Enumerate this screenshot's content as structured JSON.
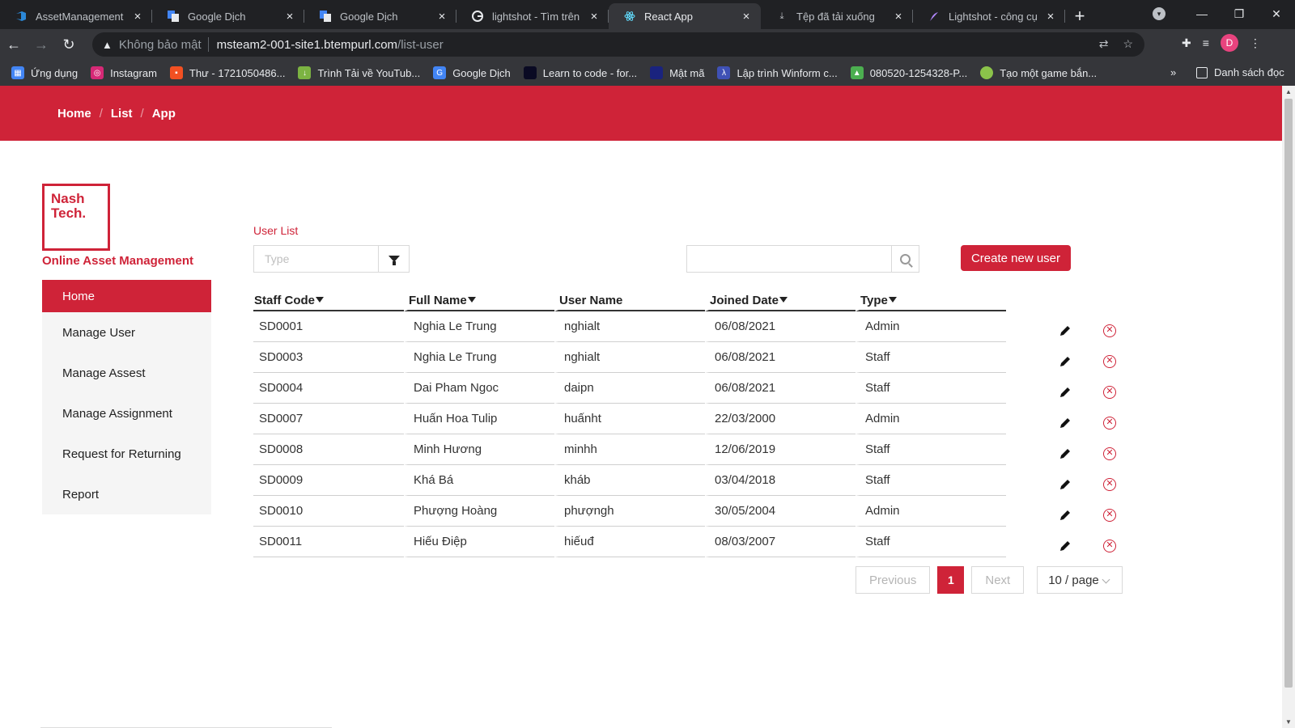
{
  "browser": {
    "tabs": [
      {
        "title": "AssetManagement Te",
        "icon": "azure-devops-icon",
        "active": false
      },
      {
        "title": "Google Dịch",
        "icon": "google-translate-icon",
        "active": false
      },
      {
        "title": "Google Dịch",
        "icon": "google-translate-icon",
        "active": false
      },
      {
        "title": "lightshot - Tìm trên G",
        "icon": "google-icon",
        "active": false
      },
      {
        "title": "React App",
        "icon": "react-icon",
        "active": true
      },
      {
        "title": "Tệp đã tải xuống",
        "icon": "download-icon",
        "active": false
      },
      {
        "title": "Lightshot - công cụ c",
        "icon": "feather-icon",
        "active": false
      }
    ],
    "address": {
      "security_label": "Không bảo mật",
      "host": "msteam2-001-site1.btempurl.com",
      "path": "/list-user"
    },
    "profile_initial": "D",
    "bookmarks": [
      {
        "label": "Ứng dụng",
        "icon": "apps-grid-icon",
        "color": "#4285f4"
      },
      {
        "label": "Instagram",
        "icon": "instagram-icon",
        "color": "#d62976"
      },
      {
        "label": "Thư - 1721050486...",
        "icon": "microsoft-icon",
        "color": "#f25022"
      },
      {
        "label": "Trình Tải về YouTub...",
        "icon": "download-arrow-icon",
        "color": "#7cb342"
      },
      {
        "label": "Google Dịch",
        "icon": "google-translate-icon",
        "color": "#4285f4"
      },
      {
        "label": "Learn to code - for...",
        "icon": "freecodecamp-icon",
        "color": "#0a0a23"
      },
      {
        "label": "Mật mã",
        "icon": "lock-icon",
        "color": "#1a237e"
      },
      {
        "label": "Lập trình Winform c...",
        "icon": "bookmark-icon",
        "color": "#3f51b5"
      },
      {
        "label": "080520-1254328-P...",
        "icon": "android-icon",
        "color": "#4caf50"
      },
      {
        "label": "Tạo một game bắn...",
        "icon": "leaf-icon",
        "color": "#8bc34a"
      }
    ],
    "more": "»",
    "reading_list": "Danh sách đọc"
  },
  "header": {
    "breadcrumbs": [
      "Home",
      "List",
      "App"
    ],
    "separator": "/"
  },
  "sidebar": {
    "logo_line1": "Nash",
    "logo_line2": "Tech.",
    "app_title": "Online Asset Management",
    "items": [
      {
        "label": "Home",
        "active": true
      },
      {
        "label": "Manage User",
        "active": false
      },
      {
        "label": "Manage Assest",
        "active": false
      },
      {
        "label": "Manage Assignment",
        "active": false
      },
      {
        "label": "Request for Returning",
        "active": false
      },
      {
        "label": "Report",
        "active": false
      }
    ]
  },
  "main": {
    "section_title": "User List",
    "type_filter_placeholder": "Type",
    "search_value": "",
    "create_button": "Create new user",
    "columns": [
      "Staff Code",
      "Full Name",
      "User Name",
      "Joined Date",
      "Type"
    ],
    "rows": [
      [
        "SD0001",
        "Nghia Le Trung",
        "nghialt",
        "06/08/2021",
        "Admin"
      ],
      [
        "SD0003",
        "Nghia Le Trung",
        "nghialt",
        "06/08/2021",
        "Staff"
      ],
      [
        "SD0004",
        "Dai Pham Ngoc",
        "daipn",
        "06/08/2021",
        "Staff"
      ],
      [
        "SD0007",
        "Huấn Hoa Tulip",
        "huấnht",
        "22/03/2000",
        "Admin"
      ],
      [
        "SD0008",
        "Minh Hương",
        "minhh",
        "12/06/2019",
        "Staff"
      ],
      [
        "SD0009",
        "Khá Bá",
        "kháb",
        "03/04/2018",
        "Staff"
      ],
      [
        "SD0010",
        "Phượng Hoàng",
        "phượngh",
        "30/05/2004",
        "Admin"
      ],
      [
        "SD0011",
        "Hiếu Điệp",
        "hiếuđ",
        "08/03/2007",
        "Staff"
      ]
    ],
    "pagination": {
      "previous": "Previous",
      "current_page": "1",
      "next": "Next",
      "page_size": "10 / page"
    }
  },
  "colors": {
    "brand_red": "#cf2338",
    "browser_dark": "#202124",
    "browser_toolbar": "#35363a"
  }
}
